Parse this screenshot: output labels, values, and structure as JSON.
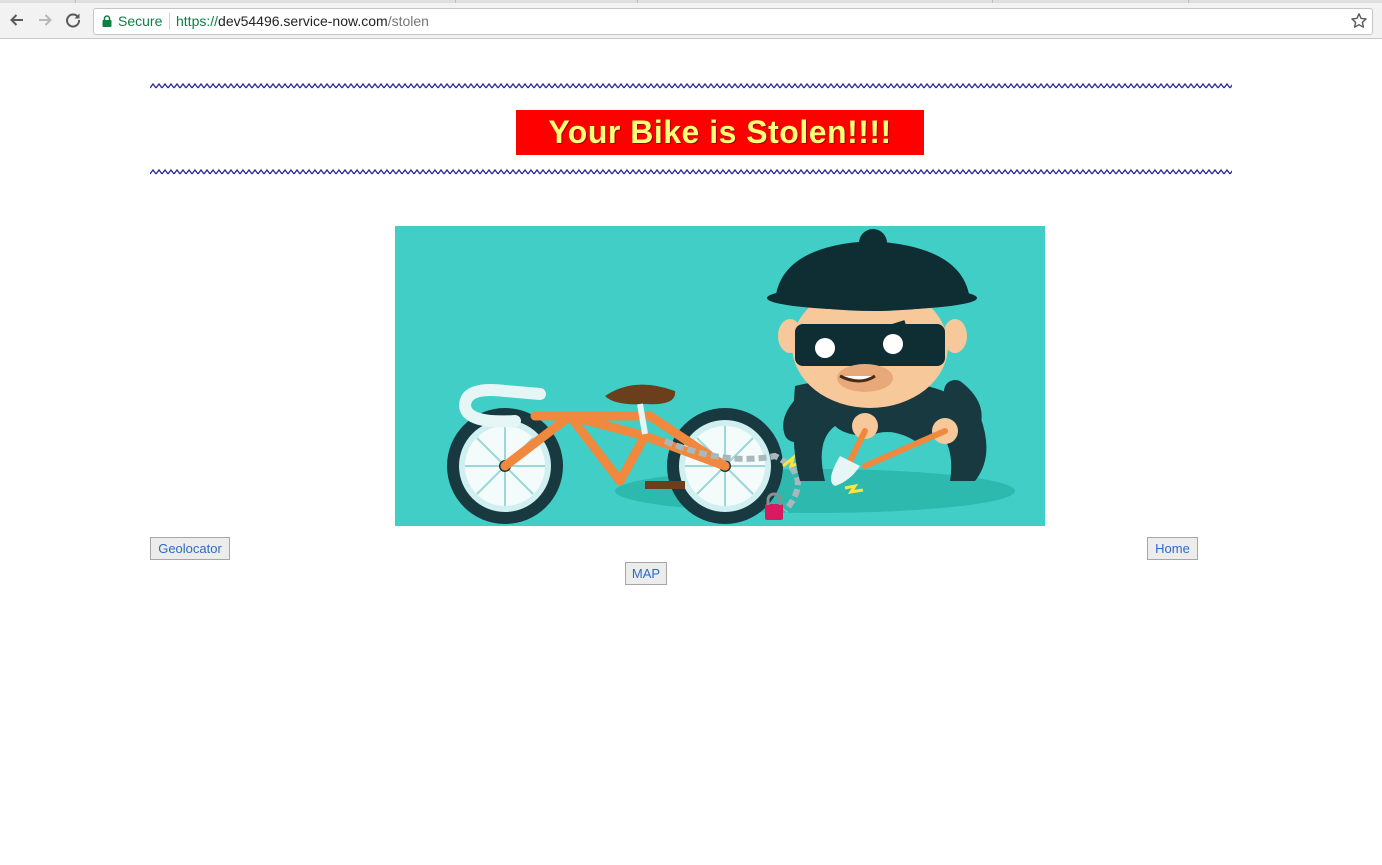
{
  "browser": {
    "secure_label": "Secure",
    "url_scheme": "https://",
    "url_host": "dev54496.service-now.com",
    "url_path": "/stolen"
  },
  "page": {
    "title": "Your Bike is Stolen!!!!",
    "hero_image": "bike-thief-illustration",
    "colors": {
      "title_background": "#ff0000",
      "title_text": "#ffff7a",
      "divider": "#2a2a9a",
      "hero_background": "#41cec6",
      "link_text": "#2b6cc4"
    }
  },
  "buttons": {
    "geolocator": "Geolocator",
    "home": "Home",
    "map": "MAP"
  }
}
